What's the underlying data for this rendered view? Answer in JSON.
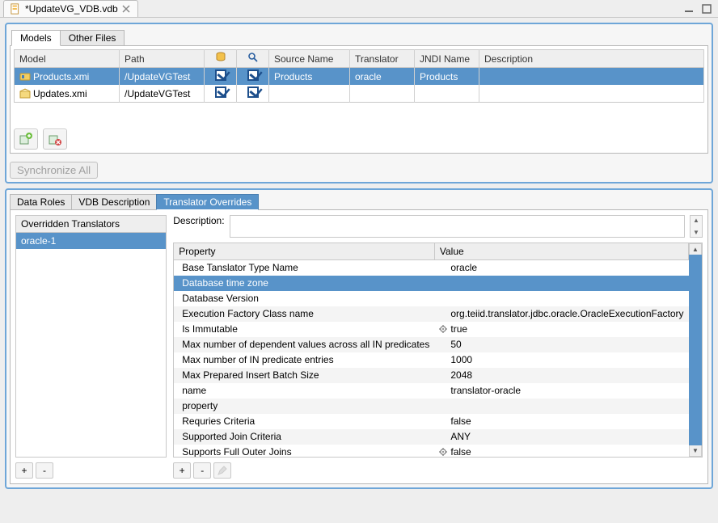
{
  "editor": {
    "file_tab_label": "*UpdateVG_VDB.vdb"
  },
  "top": {
    "tabs": {
      "models": "Models",
      "other_files": "Other Files"
    },
    "columns": {
      "model": "Model",
      "path": "Path",
      "source_name": "Source Name",
      "translator": "Translator",
      "jndi_name": "JNDI Name",
      "description": "Description"
    },
    "rows": [
      {
        "model": "Products.xmi",
        "path": "/UpdateVGTest",
        "c1": true,
        "c2": true,
        "source_name": "Products",
        "translator": "oracle",
        "jndi_name": "Products",
        "description": "",
        "selected": true,
        "icon": "source"
      },
      {
        "model": "Updates.xmi",
        "path": "/UpdateVGTest",
        "c1": true,
        "c2": true,
        "source_name": "",
        "translator": "",
        "jndi_name": "",
        "description": "",
        "selected": false,
        "icon": "view"
      }
    ],
    "sync_button": "Synchronize All"
  },
  "bottom": {
    "tabs": {
      "data_roles": "Data Roles",
      "vdb_desc": "VDB Description",
      "overrides": "Translator Overrides"
    },
    "overridden_header": "Overridden Translators",
    "overridden_items": [
      {
        "label": "oracle-1",
        "selected": true
      }
    ],
    "description_label": "Description:",
    "description_value": "",
    "prop_columns": {
      "property": "Property",
      "value": "Value"
    },
    "properties": [
      {
        "name": "Base Tanslator Type Name",
        "value": "oracle",
        "gear": false
      },
      {
        "name": "Database time zone",
        "value": "",
        "selected": true,
        "gear": false
      },
      {
        "name": "Database Version",
        "value": "",
        "gear": false
      },
      {
        "name": "Execution Factory Class name",
        "value": "org.teiid.translator.jdbc.oracle.OracleExecutionFactory",
        "gear": false
      },
      {
        "name": "Is Immutable",
        "value": "true",
        "gear": true
      },
      {
        "name": "Max number of dependent values across all IN predicates",
        "value": "50",
        "gear": false
      },
      {
        "name": "Max number of IN predicate entries",
        "value": "1000",
        "gear": false
      },
      {
        "name": "Max Prepared Insert Batch Size",
        "value": "2048",
        "gear": false
      },
      {
        "name": "name",
        "value": "translator-oracle",
        "gear": false
      },
      {
        "name": "property",
        "value": "",
        "gear": false
      },
      {
        "name": "Requries Criteria",
        "value": "false",
        "gear": false
      },
      {
        "name": "Supported Join Criteria",
        "value": "ANY",
        "gear": false
      },
      {
        "name": "Supports Full Outer Joins",
        "value": "false",
        "gear": true
      }
    ]
  }
}
